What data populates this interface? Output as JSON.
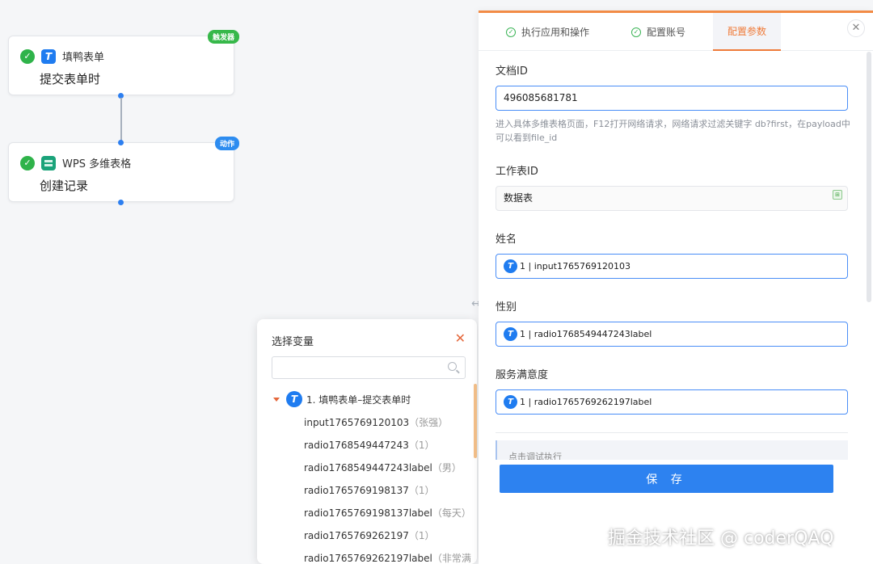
{
  "workflow": {
    "nodes": [
      {
        "app_name": "填鸭表单",
        "title": "提交表单时",
        "badge": "触发器"
      },
      {
        "app_name": "WPS 多维表格",
        "title": "创建记录",
        "badge": "动作"
      }
    ]
  },
  "variable_picker": {
    "title": "选择变量",
    "search_placeholder": "",
    "group_label": "1. 填鸭表单–提交表单时",
    "items": [
      {
        "name": "input1765769120103",
        "sample": "（张强）"
      },
      {
        "name": "radio1768549447243",
        "sample": "（1）"
      },
      {
        "name": "radio1768549447243label",
        "sample": "（男）"
      },
      {
        "name": "radio1765769198137",
        "sample": "（1）"
      },
      {
        "name": "radio1765769198137label",
        "sample": "（每天）"
      },
      {
        "name": "radio1765769262197",
        "sample": "（1）"
      },
      {
        "name": "radio1765769262197label",
        "sample": "（非常满"
      }
    ]
  },
  "config_panel": {
    "tabs": [
      {
        "label": "执行应用和操作"
      },
      {
        "label": "配置账号"
      },
      {
        "label": "配置参数"
      }
    ],
    "fields": {
      "doc_id": {
        "label": "文档ID",
        "value": "496085681781",
        "hint": "进入具体多维表格页面，F12打开网络请求，网络请求过滤关键字 db?first，在payload中可以看到file_id"
      },
      "sheet_id": {
        "label": "工作表ID",
        "value": "数据表"
      },
      "name": {
        "label": "姓名",
        "value": "1 | input1765769120103"
      },
      "gender": {
        "label": "性别",
        "value": "1 | radio1768549447243label"
      },
      "satisfaction": {
        "label": "服务满意度",
        "value": "1 | radio1765769262197label"
      }
    },
    "debug_text": "点击调试执行",
    "save_label": "保 存"
  },
  "watermark": "掘金技术社区 @ coderQAQ"
}
